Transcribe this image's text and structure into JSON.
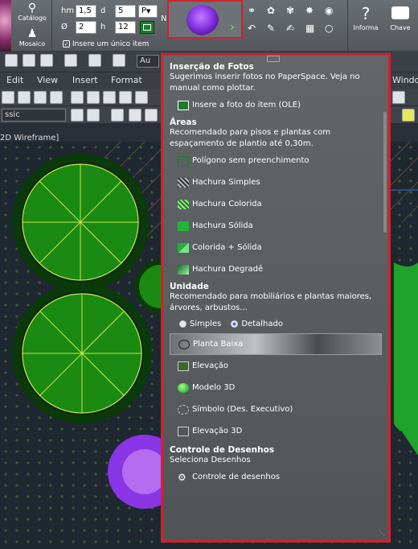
{
  "ribbon": {
    "catalogo_label": "Catálogo",
    "mosaico_label": "Mosaico",
    "hm_label": "hm",
    "hm_value": "1,5",
    "d_label": "d",
    "d_value": "5",
    "p_select": "P",
    "diam_label": "Ø",
    "diam_value": "2",
    "h_label": "h",
    "h_value": "12",
    "n_label": "N",
    "hint": "Insere um único item",
    "informa_label": "Informa",
    "chave_label": "Chave"
  },
  "menubar": {
    "items": [
      "Edit",
      "View",
      "Insert",
      "Format",
      "Windo"
    ]
  },
  "toolbar": {
    "style_combo": "ssic",
    "au_label": "Au"
  },
  "viewport": {
    "label": "2D Wireframe]"
  },
  "popup": {
    "sections": [
      {
        "title": "Inserção de Fotos",
        "desc": "Sugerimos inserir fotos no PaperSpace. Veja no manual como plottar.",
        "items": [
          {
            "label": "Insere a foto do item (OLE)",
            "icon": "photo-icon"
          }
        ]
      },
      {
        "title": "Áreas",
        "desc": "Recomendado para pisos e plantas com espaçamento de plantio até 0,30m.",
        "items": [
          {
            "label": "Polígono sem preenchimento",
            "icon": "polygon-icon"
          },
          {
            "label": "Hachura Simples",
            "icon": "hatch-simple-icon"
          },
          {
            "label": "Hachura Colorida",
            "icon": "hatch-color-icon"
          },
          {
            "label": "Hachura Sólida",
            "icon": "hatch-solid-icon"
          },
          {
            "label": "Colorida + Sólida",
            "icon": "color-solid-icon"
          },
          {
            "label": "Hachura Degradê",
            "icon": "hatch-gradient-icon"
          }
        ]
      },
      {
        "title": "Unidade",
        "desc": "Recomendado para mobiliários e plantas maiores, árvores, arbustos...",
        "radio": {
          "simples": "Simples",
          "detalhado": "Detalhado",
          "selected": "detalhado"
        },
        "items": [
          {
            "label": "Planta Baixa",
            "icon": "plan-icon",
            "highlighted": true
          },
          {
            "label": "Elevação",
            "icon": "elevation-icon"
          },
          {
            "label": "Modelo 3D",
            "icon": "model3d-icon"
          },
          {
            "label": "Símbolo (Des. Executivo)",
            "icon": "symbol-icon"
          },
          {
            "label": "Elevação 3D",
            "icon": "elevation3d-icon"
          }
        ]
      },
      {
        "title": "Controle de Desenhos",
        "desc": "Seleciona Desenhos",
        "items": [
          {
            "label": "Controle de desenhos",
            "icon": "gear-icon"
          }
        ]
      }
    ]
  },
  "colors": {
    "accent_red": "#d1222b",
    "plant_green": "#1a8a12",
    "plant_purple": "#8a35e6"
  }
}
